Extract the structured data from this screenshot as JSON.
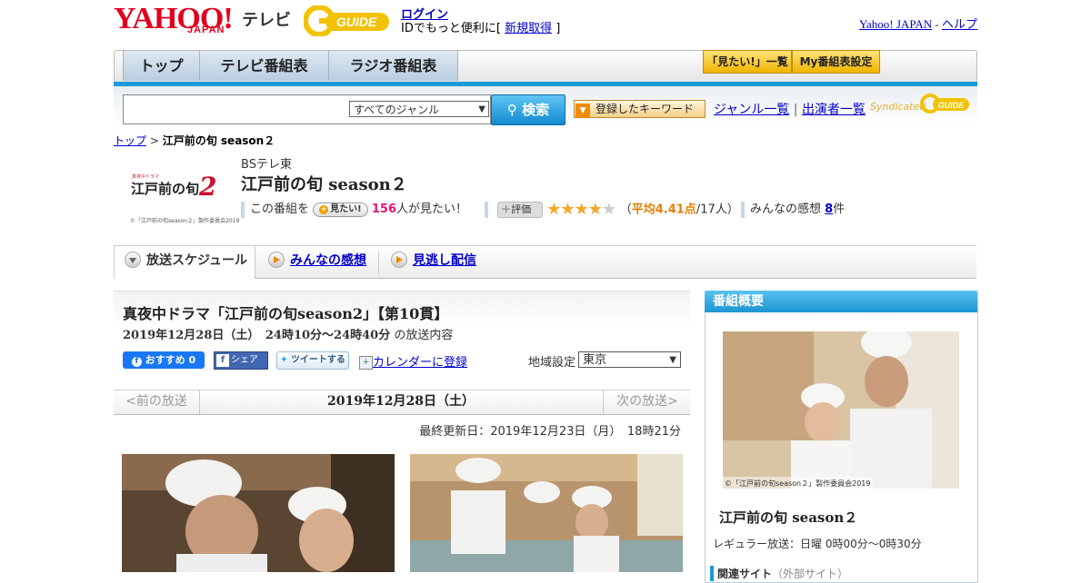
{
  "header": {
    "yahoo_logo": "YAHOO!",
    "yahoo_japan": "JAPAN",
    "tv_label": "テレビ",
    "gguide_logo": "G-GUIDE",
    "login": "ログイン",
    "login_prompt": "IDでもっと便利に[",
    "register": "新規取得",
    "login_suffix": "]",
    "yahoo_japan_link": "Yahoo! JAPAN",
    "separator": "-",
    "help": "ヘルプ"
  },
  "nav": {
    "tabs": [
      "トップ",
      "テレビ番組表",
      "ラジオ番組表"
    ],
    "mitai_list": "「見たい!」一覧",
    "my_settings": "My番組表設定"
  },
  "search": {
    "input_value": "",
    "genre_selected": "すべてのジャンル",
    "button": "検索",
    "keyword_button": "登録したキーワード",
    "genre_list": "ジャンル一覧",
    "divider": "|",
    "cast_list": "出演者一覧",
    "syndicated": "Syndicated"
  },
  "breadcrumb": {
    "top": "トップ",
    "sep": ">",
    "current": "江戸前の旬 season２"
  },
  "program": {
    "logo_small": "真夜中ドラマ",
    "logo_title": "江戸前の旬",
    "logo_num": "2",
    "logo_copyright": "©「江戸前の旬season２」製作委員会2019",
    "station": "BSテレ東",
    "title": "江戸前の旬 season２",
    "mitai_prefix": "この番組を",
    "mitai_button": "見たい!",
    "mitai_count": "156",
    "mitai_suffix": "人が見たい！",
    "rating_button": "評価",
    "rating_open": "（",
    "rating_avg": "平均4.41点",
    "rating_count": "/17人）",
    "rating_value": 4.41,
    "impressions_label": "みんなの感想",
    "impressions_count": "8",
    "impressions_suffix": "件"
  },
  "tabs": {
    "schedule": "放送スケジュール",
    "impressions": "みんなの感想",
    "streaming": "見逃し配信"
  },
  "episode": {
    "title": "真夜中ドラマ「江戸前の旬season2」【第10貫】",
    "date": "2019年12月28日（土）　24時10分～24時40分",
    "date_suffix": "の放送内容",
    "fb_recommend": "おすすめ 0",
    "fb_share": "シェア",
    "tweet": "ツイートする",
    "calendar": "カレンダーに登録",
    "region_label": "地域設定",
    "region_value": "東京",
    "prev": "<前の放送",
    "current_date": "2019年12月28日（土）",
    "next": "次の放送>",
    "updated": "最終更新日：2019年12月23日（月）　18時21分"
  },
  "side": {
    "heading": "番組概要",
    "photo_caption": "©「江戸前の旬season２」製作委員会2019",
    "title": "江戸前の旬 season２",
    "regular": "レギュラー放送：日曜 0時00分～0時30分",
    "related": "関連サイト",
    "related_note": "（外部サイト）"
  },
  "colors": {
    "accent_blue": "#1a9ad8",
    "yahoo_red": "#e0001e",
    "gguide_yellow": "#f2c200",
    "link": "#0000cc",
    "pink": "#e4177a",
    "star": "#f5a623"
  }
}
